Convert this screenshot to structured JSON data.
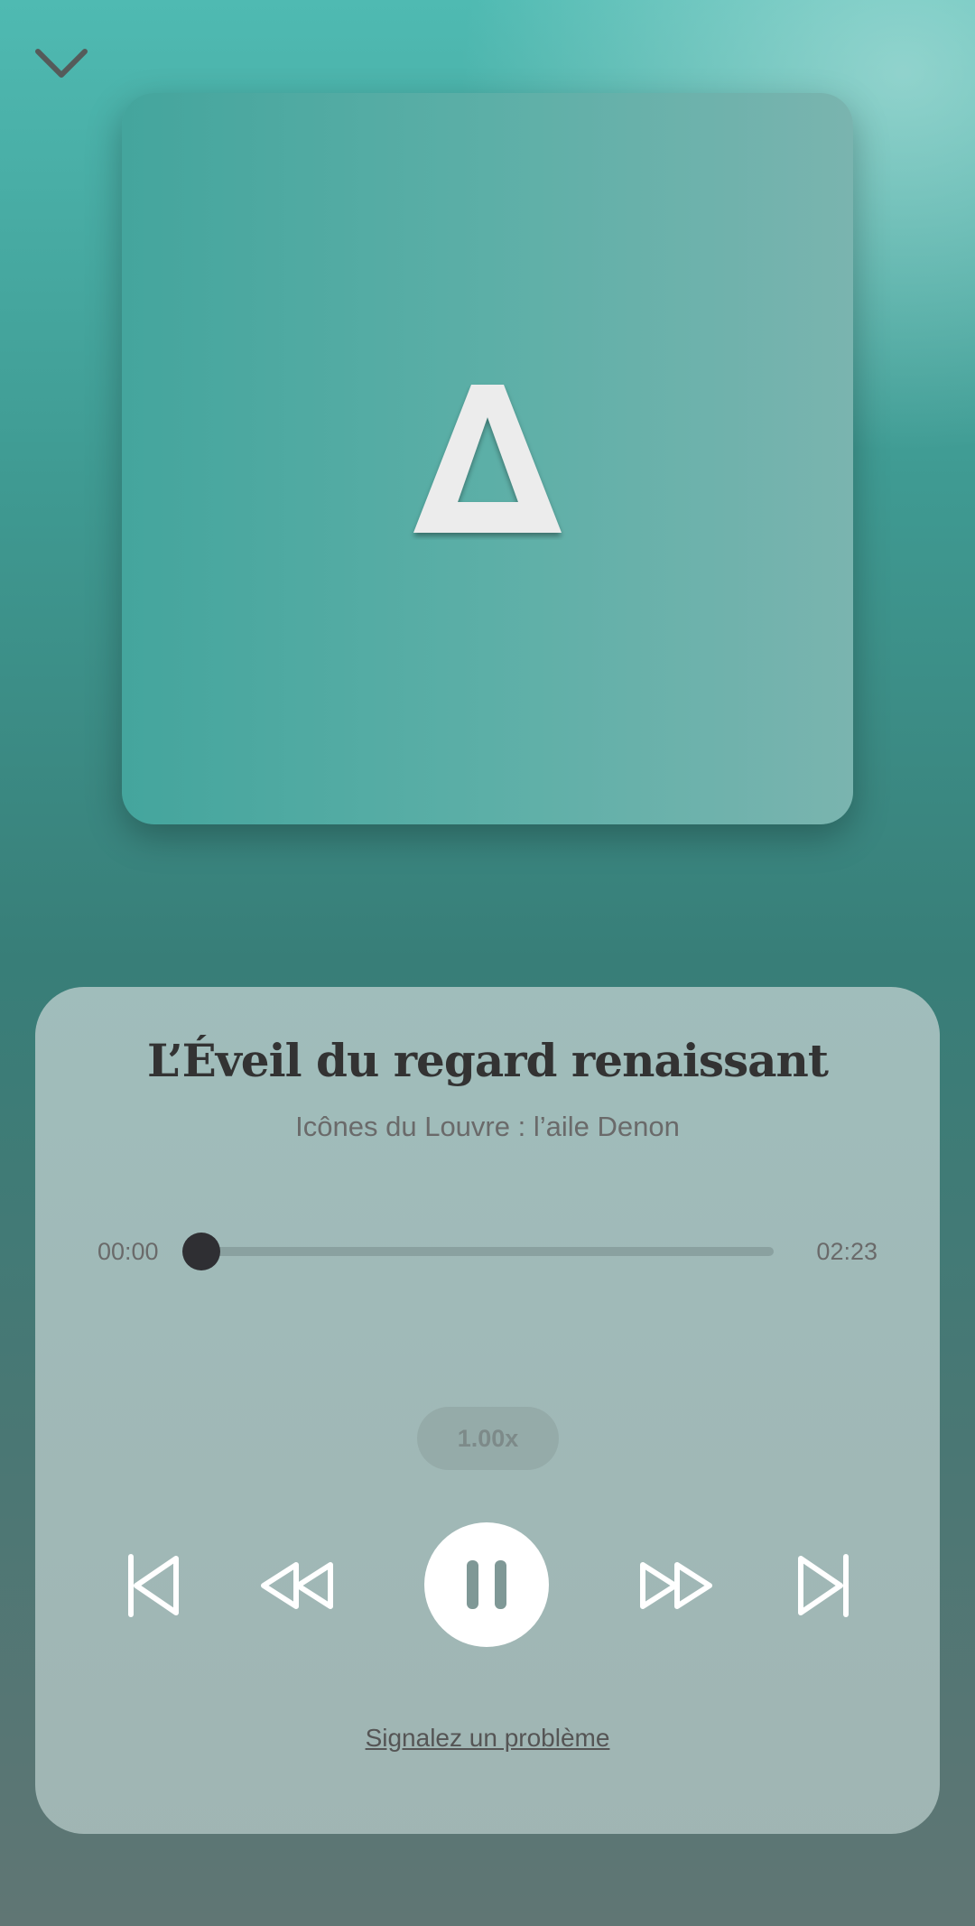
{
  "header": {
    "collapse_icon": "chevron-down-icon"
  },
  "artwork": {
    "logo_icon": "delta-triangle-icon",
    "logo_text": "Δ"
  },
  "track": {
    "title": "L’Éveil du regard renaissant",
    "subtitle": "Icônes du Louvre : l’aile Denon"
  },
  "progress": {
    "elapsed": "00:00",
    "total": "02:23",
    "fraction": 0.0
  },
  "controls": {
    "speed_label": "1.00x",
    "skip_previous_icon": "skip-previous-icon",
    "rewind_icon": "rewind-icon",
    "pause_icon": "pause-icon",
    "fast_forward_icon": "fast-forward-icon",
    "skip_next_icon": "skip-next-icon"
  },
  "footer": {
    "report_link": "Signalez un problème"
  },
  "colors": {
    "accent_teal": "#4fbab2",
    "panel": "#a9bfbd",
    "thumb": "#2f2f33"
  }
}
